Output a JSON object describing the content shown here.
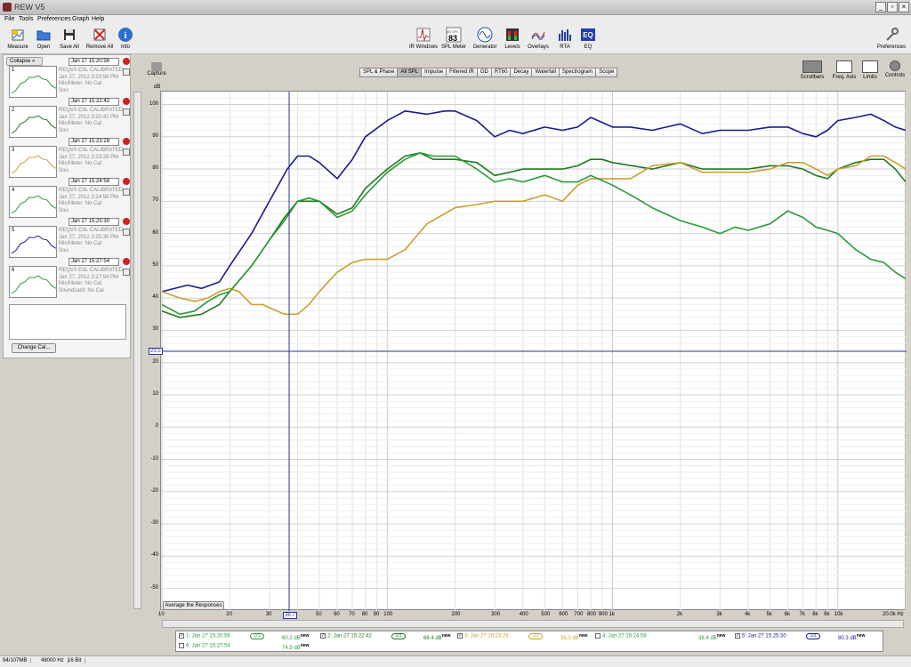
{
  "window": {
    "title": "REW V5"
  },
  "menu": [
    "File",
    "Tools",
    "Preferences",
    "Graph",
    "Help"
  ],
  "toolbar_left": [
    {
      "label": "Measure",
      "icon": "measure-icon"
    },
    {
      "label": "Open",
      "icon": "folder-icon"
    },
    {
      "label": "Save All",
      "icon": "floppy-icon"
    },
    {
      "label": "Remove All",
      "icon": "remove-icon"
    },
    {
      "label": "Info",
      "icon": "info-icon"
    }
  ],
  "toolbar_center": [
    {
      "label": "IR Windows",
      "icon": "ir-windows-icon"
    },
    {
      "label": "SPL Meter",
      "icon": "spl-meter-icon",
      "badge": "83",
      "badge_top": "dB SPL"
    },
    {
      "label": "Generator",
      "icon": "sine-icon"
    },
    {
      "label": "Levels",
      "icon": "levels-icon"
    },
    {
      "label": "Overlays",
      "icon": "overlays-icon"
    },
    {
      "label": "RTA",
      "icon": "rta-icon"
    },
    {
      "label": "EQ",
      "icon": "eq-icon"
    }
  ],
  "toolbar_right": {
    "label": "Preferences",
    "icon": "wrench-icon"
  },
  "left_panel": {
    "collapse_label": "Collapse",
    "measurements": [
      {
        "num": "1",
        "tab": "Jan 27 15:20:56",
        "name": "REQV5 ESL CALIBRATED",
        "date": "Jan 27, 2012 3:20:56 PM",
        "mic": "Mic/Meter: No Cal",
        "sound": "Sou",
        "color": "#2a9a3a"
      },
      {
        "num": "2",
        "tab": "Jan 27 15:22:42",
        "name": "REQV5 ESL CALIBRATED",
        "date": "Jan 27, 2012 3:22:42 PM",
        "mic": "Mic/Meter: No Cal",
        "sound": "Sou",
        "color": "#1f7a1f"
      },
      {
        "num": "3",
        "tab": "Jan 27 15:23:28",
        "name": "REQV5 ESL CALIBRATED",
        "date": "Jan 27, 2012 3:23:28 PM",
        "mic": "Mic/Meter: No Cal",
        "sound": "Sou",
        "color": "#c8a030"
      },
      {
        "num": "4",
        "tab": "Jan 27 15:24:58",
        "name": "REQV5 ESL CALIBRATED",
        "date": "Jan 27, 2012 3:24:58 PM",
        "mic": "Mic/Meter: No Cal",
        "sound": "Sou",
        "color": "#2a9a3a"
      },
      {
        "num": "5",
        "tab": "Jan 27 15:25:30",
        "name": "REQV5 ESL CALIBRATED",
        "date": "Jan 27, 2012 3:25:30 PM",
        "mic": "Mic/Meter: No Cal",
        "sound": "Sou",
        "color": "#1a1a90"
      },
      {
        "num": "6",
        "tab": "Jan 27 15:27:54",
        "name": "REQV5 ESL CALIBRATED",
        "date": "Jan 27, 2012 3:27:54 PM",
        "mic": "Mic/Meter: No Cal",
        "sound": "Soundcard: No Cal",
        "color": "#2a9a3a"
      }
    ],
    "change_cal_label": "Change Cal..."
  },
  "capture_label": "Capture",
  "tabs": [
    "SPL & Phase",
    "All SPL",
    "Impulse",
    "Filtered IR",
    "GD",
    "RT60",
    "Decay",
    "Waterfall",
    "Spectrogram",
    "Scope"
  ],
  "active_tab": "All SPL",
  "right_tools": [
    {
      "label": "Scrollbars",
      "icon": "scrollbars-icon"
    },
    {
      "label": "Freq. Axis",
      "icon": "freq-axis-icon"
    },
    {
      "label": "Limits",
      "icon": "limits-icon"
    },
    {
      "label": "Controls",
      "icon": "controls-icon"
    }
  ],
  "average_button": "Average the Responses",
  "cursor": {
    "freq_label": "36.7",
    "level_label": "23.5"
  },
  "chart_data": {
    "type": "line",
    "ylabel": "dB",
    "xscale": "log",
    "xlim": [
      10,
      20000
    ],
    "ylim": [
      -57,
      104
    ],
    "y_ticks": [
      100,
      90,
      80,
      70,
      60,
      50,
      40,
      30,
      20,
      10,
      0,
      -10,
      -20,
      -30,
      -40,
      -50
    ],
    "x_ticks": [
      {
        "v": 10,
        "l": "10"
      },
      {
        "v": 20,
        "l": "20"
      },
      {
        "v": 30,
        "l": "30"
      },
      {
        "v": 50,
        "l": "50"
      },
      {
        "v": 60,
        "l": "60"
      },
      {
        "v": 70,
        "l": "70"
      },
      {
        "v": 80,
        "l": "80"
      },
      {
        "v": 90,
        "l": "90"
      },
      {
        "v": 100,
        "l": "100"
      },
      {
        "v": 200,
        "l": "200"
      },
      {
        "v": 300,
        "l": "300"
      },
      {
        "v": 400,
        "l": "400"
      },
      {
        "v": 500,
        "l": "500"
      },
      {
        "v": 600,
        "l": "600"
      },
      {
        "v": 700,
        "l": "700"
      },
      {
        "v": 800,
        "l": "800"
      },
      {
        "v": 900,
        "l": "900"
      },
      {
        "v": 1000,
        "l": "1k"
      },
      {
        "v": 2000,
        "l": "2k"
      },
      {
        "v": 3000,
        "l": "3k"
      },
      {
        "v": 4000,
        "l": "4k"
      },
      {
        "v": 5000,
        "l": "5k"
      },
      {
        "v": 6000,
        "l": "6k"
      },
      {
        "v": 7000,
        "l": "7k"
      },
      {
        "v": 8000,
        "l": "8k"
      },
      {
        "v": 9000,
        "l": "9k"
      },
      {
        "v": 10000,
        "l": "10k"
      },
      {
        "v": 20000,
        "l": "20.0k Hz"
      }
    ],
    "cursor_x": 36.7,
    "cursor_y": 23.5,
    "series": [
      {
        "color": "#1a1a90",
        "points": [
          [
            10,
            42
          ],
          [
            13,
            44
          ],
          [
            15,
            43
          ],
          [
            18,
            45
          ],
          [
            20,
            50
          ],
          [
            25,
            60
          ],
          [
            30,
            70
          ],
          [
            36,
            80
          ],
          [
            40,
            84
          ],
          [
            45,
            84
          ],
          [
            50,
            82
          ],
          [
            60,
            77
          ],
          [
            70,
            83
          ],
          [
            80,
            90
          ],
          [
            100,
            95
          ],
          [
            120,
            98
          ],
          [
            150,
            97
          ],
          [
            180,
            98
          ],
          [
            200,
            98
          ],
          [
            250,
            95
          ],
          [
            300,
            90
          ],
          [
            350,
            92
          ],
          [
            400,
            91
          ],
          [
            500,
            93
          ],
          [
            600,
            92
          ],
          [
            700,
            93
          ],
          [
            800,
            96
          ],
          [
            1000,
            93
          ],
          [
            1200,
            93
          ],
          [
            1500,
            92
          ],
          [
            2000,
            94
          ],
          [
            2500,
            91
          ],
          [
            3000,
            92
          ],
          [
            4000,
            92
          ],
          [
            5000,
            93
          ],
          [
            6000,
            93
          ],
          [
            7000,
            91
          ],
          [
            8000,
            90
          ],
          [
            9000,
            92
          ],
          [
            10000,
            95
          ],
          [
            12000,
            96
          ],
          [
            14000,
            97
          ],
          [
            16000,
            95
          ],
          [
            18000,
            93
          ],
          [
            20000,
            92
          ]
        ]
      },
      {
        "color": "#1f7a1f",
        "points": [
          [
            10,
            36
          ],
          [
            12,
            34
          ],
          [
            15,
            35
          ],
          [
            18,
            38
          ],
          [
            20,
            42
          ],
          [
            25,
            50
          ],
          [
            30,
            58
          ],
          [
            35,
            65
          ],
          [
            40,
            70
          ],
          [
            45,
            70
          ],
          [
            50,
            70
          ],
          [
            60,
            66
          ],
          [
            70,
            68
          ],
          [
            80,
            74
          ],
          [
            100,
            80
          ],
          [
            120,
            84
          ],
          [
            140,
            85
          ],
          [
            160,
            83
          ],
          [
            200,
            83
          ],
          [
            250,
            82
          ],
          [
            300,
            78
          ],
          [
            350,
            79
          ],
          [
            400,
            80
          ],
          [
            500,
            80
          ],
          [
            600,
            80
          ],
          [
            700,
            81
          ],
          [
            800,
            83
          ],
          [
            900,
            83
          ],
          [
            1000,
            82
          ],
          [
            1500,
            80
          ],
          [
            2000,
            82
          ],
          [
            2500,
            80
          ],
          [
            3000,
            80
          ],
          [
            4000,
            80
          ],
          [
            5000,
            81
          ],
          [
            6000,
            81
          ],
          [
            7000,
            80
          ],
          [
            8000,
            78
          ],
          [
            9000,
            77
          ],
          [
            10000,
            80
          ],
          [
            12000,
            82
          ],
          [
            14000,
            83
          ],
          [
            16000,
            83
          ],
          [
            18000,
            80
          ],
          [
            20000,
            76
          ]
        ]
      },
      {
        "color": "#c8a030",
        "points": [
          [
            10,
            42
          ],
          [
            12,
            40
          ],
          [
            14,
            39
          ],
          [
            16,
            40
          ],
          [
            18,
            42
          ],
          [
            20,
            43
          ],
          [
            22,
            42
          ],
          [
            25,
            38
          ],
          [
            28,
            38
          ],
          [
            30,
            37
          ],
          [
            35,
            35
          ],
          [
            40,
            35
          ],
          [
            45,
            38
          ],
          [
            50,
            42
          ],
          [
            60,
            48
          ],
          [
            70,
            51
          ],
          [
            80,
            52
          ],
          [
            100,
            52
          ],
          [
            120,
            55
          ],
          [
            150,
            63
          ],
          [
            200,
            68
          ],
          [
            250,
            69
          ],
          [
            300,
            70
          ],
          [
            350,
            70
          ],
          [
            400,
            70
          ],
          [
            500,
            72
          ],
          [
            600,
            70
          ],
          [
            700,
            75
          ],
          [
            800,
            77
          ],
          [
            1000,
            77
          ],
          [
            1200,
            77
          ],
          [
            1500,
            81
          ],
          [
            2000,
            82
          ],
          [
            2500,
            79
          ],
          [
            3000,
            79
          ],
          [
            4000,
            79
          ],
          [
            5000,
            80
          ],
          [
            6000,
            82
          ],
          [
            7000,
            82
          ],
          [
            8000,
            80
          ],
          [
            9000,
            78
          ],
          [
            10000,
            80
          ],
          [
            12000,
            81
          ],
          [
            14000,
            84
          ],
          [
            16000,
            84
          ],
          [
            18000,
            82
          ],
          [
            20000,
            80
          ]
        ]
      },
      {
        "color": "#2a9a3a",
        "points": [
          [
            10,
            38
          ],
          [
            12,
            35
          ],
          [
            14,
            36
          ],
          [
            16,
            39
          ],
          [
            18,
            41
          ],
          [
            20,
            42
          ],
          [
            25,
            50
          ],
          [
            30,
            58
          ],
          [
            35,
            64
          ],
          [
            40,
            70
          ],
          [
            45,
            71
          ],
          [
            50,
            70
          ],
          [
            60,
            65
          ],
          [
            70,
            67
          ],
          [
            80,
            72
          ],
          [
            100,
            79
          ],
          [
            120,
            83
          ],
          [
            140,
            85
          ],
          [
            160,
            84
          ],
          [
            200,
            84
          ],
          [
            250,
            80
          ],
          [
            300,
            76
          ],
          [
            350,
            77
          ],
          [
            400,
            76
          ],
          [
            500,
            78
          ],
          [
            600,
            76
          ],
          [
            700,
            76
          ],
          [
            800,
            78
          ],
          [
            1000,
            75
          ],
          [
            1200,
            72
          ],
          [
            1500,
            68
          ],
          [
            2000,
            64
          ],
          [
            2500,
            62
          ],
          [
            3000,
            60
          ],
          [
            3500,
            62
          ],
          [
            4000,
            61
          ],
          [
            5000,
            63
          ],
          [
            6000,
            67
          ],
          [
            7000,
            65
          ],
          [
            8000,
            62
          ],
          [
            9000,
            61
          ],
          [
            10000,
            60
          ],
          [
            12000,
            55
          ],
          [
            14000,
            52
          ],
          [
            16000,
            51
          ],
          [
            18000,
            48
          ],
          [
            20000,
            46
          ]
        ]
      }
    ]
  },
  "legend": {
    "items": [
      {
        "checked": true,
        "label": "1: Jan 27 15:20:56",
        "smooth": "1/3",
        "value": "60.2 dB",
        "new": "new",
        "color": "#2a9a3a"
      },
      {
        "checked": true,
        "label": "2: Jan 27 15:22:42",
        "smooth": "1/3",
        "value": "68.4 dB",
        "new": "new",
        "color": "#1f7a1f"
      },
      {
        "checked": true,
        "label": "3: Jan 27 15:23:28",
        "smooth": "1/3",
        "value": "35.0 dB",
        "new": "new",
        "color": "#c8a030"
      },
      {
        "checked": false,
        "label": "4: Jan 27 15:24:58",
        "smooth": "",
        "value": "38.4 dB",
        "new": "new",
        "color": "#2a9a3a"
      },
      {
        "checked": true,
        "label": "5: Jan 27 15:25:30",
        "smooth": "1/3",
        "value": "80.3 dB",
        "new": "new",
        "color": "#1a1a90"
      },
      {
        "checked": false,
        "label": "6: Jan 27 15:27:54",
        "smooth": "",
        "value": "74.9 dB",
        "new": "new",
        "color": "#2a9a3a"
      }
    ]
  },
  "status": {
    "memory": "94/107MB",
    "rate": "48000 Hz",
    "bits": "16 Bit"
  }
}
